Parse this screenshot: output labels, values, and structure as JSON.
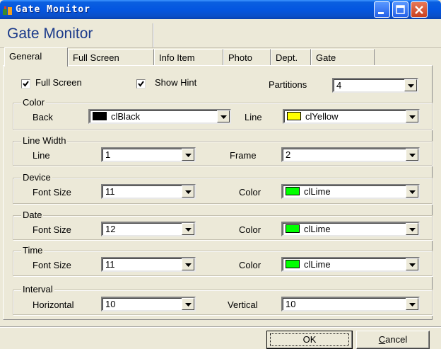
{
  "window": {
    "title": "Gate Monitor"
  },
  "header": {
    "title": "Gate Monitor"
  },
  "tabs": [
    {
      "label": "General",
      "active": true
    },
    {
      "label": "Full Screen"
    },
    {
      "label": "Info Item"
    },
    {
      "label": "Photo"
    },
    {
      "label": "Dept."
    },
    {
      "label": "Gate"
    }
  ],
  "general": {
    "full_screen": {
      "label": "Full Screen",
      "checked": true
    },
    "show_hint": {
      "label": "Show Hint",
      "checked": true
    },
    "partitions": {
      "label": "Partitions",
      "value": "4"
    }
  },
  "color_group": {
    "title": "Color",
    "back": {
      "label": "Back",
      "value": "clBlack",
      "swatch": "#000000"
    },
    "line": {
      "label": "Line",
      "value": "clYellow",
      "swatch": "#ffff00"
    }
  },
  "line_width_group": {
    "title": "Line Width",
    "line": {
      "label": "Line",
      "value": "1"
    },
    "frame": {
      "label": "Frame",
      "value": "2"
    }
  },
  "device_group": {
    "title": "Device",
    "font_size": {
      "label": "Font Size",
      "value": "11"
    },
    "color": {
      "label": "Color",
      "value": "clLime",
      "swatch": "#00ff00"
    }
  },
  "date_group": {
    "title": "Date",
    "font_size": {
      "label": "Font Size",
      "value": "12"
    },
    "color": {
      "label": "Color",
      "value": "clLime",
      "swatch": "#00ff00"
    }
  },
  "time_group": {
    "title": "Time",
    "font_size": {
      "label": "Font Size",
      "value": "11"
    },
    "color": {
      "label": "Color",
      "value": "clLime",
      "swatch": "#00ff00"
    }
  },
  "interval_group": {
    "title": "Interval",
    "horizontal": {
      "label": "Horizontal",
      "value": "10"
    },
    "vertical": {
      "label": "Vertical",
      "value": "10"
    }
  },
  "buttons": {
    "ok": {
      "label": "OK"
    },
    "cancel": {
      "label": "Cancel",
      "underline": "C",
      "rest": "ancel"
    }
  },
  "icons": [
    "app-icon",
    "minimize-icon",
    "maximize-icon",
    "close-icon",
    "checkmark-icon",
    "chevron-down-icon"
  ]
}
